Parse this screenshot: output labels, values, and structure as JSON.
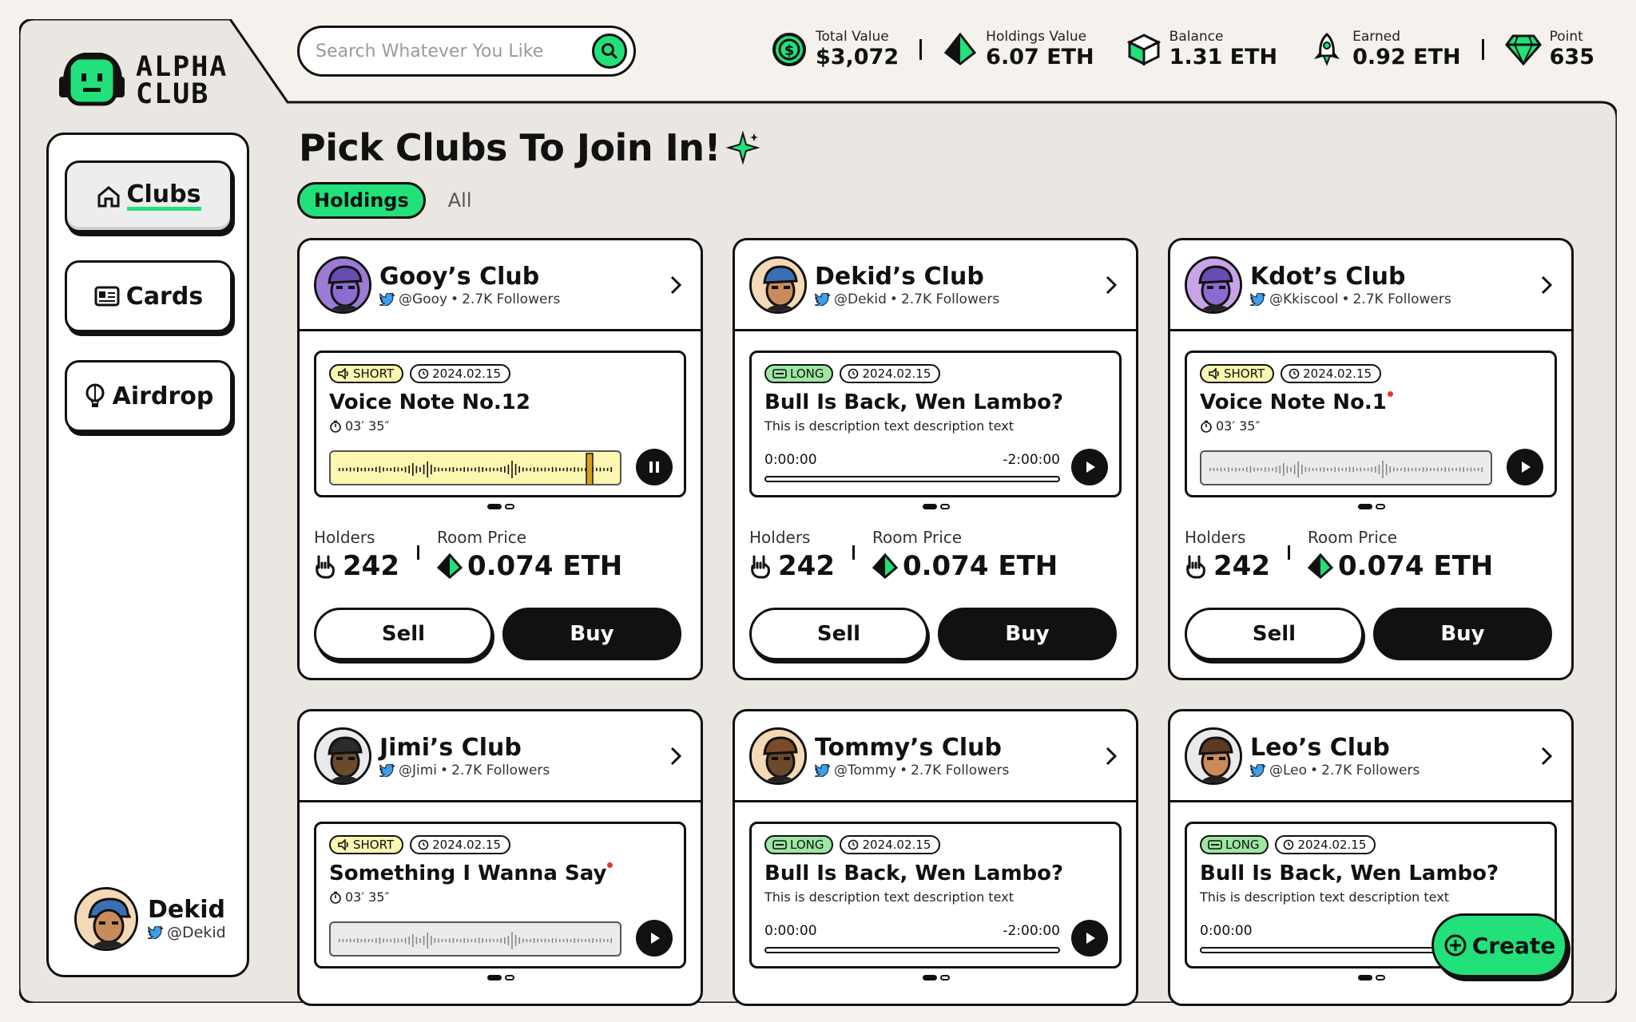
{
  "app": {
    "brand_line1": "ALPHA",
    "brand_line2": "CLUB"
  },
  "search": {
    "placeholder": "Search Whatever You Like"
  },
  "stats": [
    {
      "label": "Total Value",
      "value": "$3,072",
      "icon": "dollar-coin-icon"
    },
    {
      "label": "Holdings Value",
      "value": "6.07 ETH",
      "icon": "eth-diamond-icon"
    },
    {
      "label": "Balance",
      "value": "1.31 ETH",
      "icon": "cube-stack-icon"
    },
    {
      "label": "Earned",
      "value": "0.92 ETH",
      "icon": "rocket-icon"
    },
    {
      "label": "Point",
      "value": "635",
      "icon": "gem-icon"
    }
  ],
  "sidebar": {
    "items": [
      {
        "label": "Clubs",
        "icon": "home-icon",
        "active": true
      },
      {
        "label": "Cards",
        "icon": "id-card-icon",
        "active": false
      },
      {
        "label": "Airdrop",
        "icon": "balloon-icon",
        "active": false
      }
    ],
    "user": {
      "name": "Dekid",
      "handle": "@Dekid"
    }
  },
  "main": {
    "title": "Pick Clubs To Join In!",
    "tabs": [
      {
        "label": "Holdings"
      },
      {
        "label": "All"
      }
    ],
    "holders_label": "Holders",
    "price_label": "Room Price",
    "sell_label": "Sell",
    "buy_label": "Buy"
  },
  "cards": [
    {
      "club": "Gooy’s Club",
      "handle": "@Gooy",
      "followers": "2.7K Followers",
      "tag": "SHORT",
      "date": "2024.02.15",
      "note": "Voice Note No.12",
      "duration": "03′ 35″",
      "holders": "242",
      "price": "0.074 ETH"
    },
    {
      "club": "Dekid’s Club",
      "handle": "@Dekid",
      "followers": "2.7K Followers",
      "tag": "LONG",
      "date": "2024.02.15",
      "note": "Bull Is Back, Wen Lambo?",
      "desc": "This is description text description text",
      "time_start": "0:00:00",
      "time_end": "-2:00:00",
      "holders": "242",
      "price": "0.074 ETH"
    },
    {
      "club": "Kdot’s Club",
      "handle": "@Kkiscool",
      "followers": "2.7K Followers",
      "tag": "SHORT",
      "date": "2024.02.15",
      "note": "Voice Note No.1",
      "duration": "03′ 35″",
      "holders": "242",
      "price": "0.074 ETH"
    },
    {
      "club": "Jimi’s Club",
      "handle": "@Jimi",
      "followers": "2.7K Followers",
      "tag": "SHORT",
      "date": "2024.02.15",
      "note": "Something I Wanna Say",
      "duration": "03′ 35″"
    },
    {
      "club": "Tommy’s Club",
      "handle": "@Tommy",
      "followers": "2.7K Followers",
      "tag": "LONG",
      "date": "2024.02.15",
      "note": "Bull Is Back, Wen Lambo?",
      "desc": "This is description text description text",
      "time_start": "0:00:00",
      "time_end": "-2:00:00"
    },
    {
      "club": "Leo’s Club",
      "handle": "@Leo",
      "followers": "2.7K Followers",
      "tag": "LONG",
      "date": "2024.02.15",
      "note": "Bull Is Back, Wen Lambo?",
      "desc": "This is description text description text",
      "time_start": "0:00:00"
    }
  ],
  "create": {
    "label": "Create"
  },
  "colors": {
    "accent": "#22e07a",
    "ink": "#111111",
    "bg": "#f5f2ee",
    "short_tag": "#fbf6b0",
    "long_tag": "#9ee7a2"
  }
}
